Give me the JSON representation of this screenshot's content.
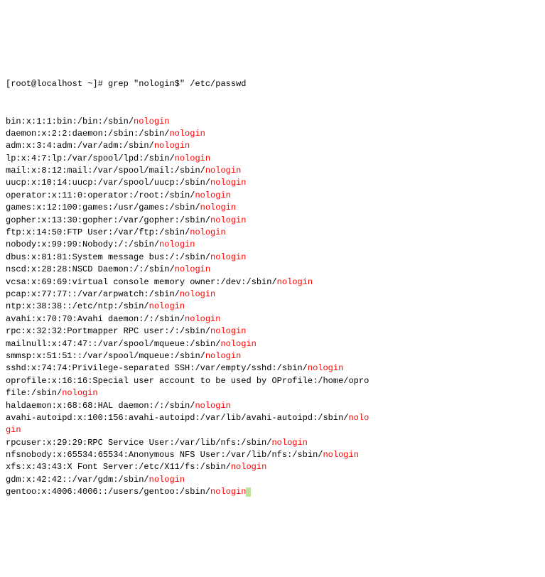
{
  "prompt": "[root@localhost ~]# ",
  "command": "grep \"nologin$\" /etc/passwd",
  "match": "nologin",
  "entries": [
    "bin:x:1:1:bin:/bin:/sbin/",
    "daemon:x:2:2:daemon:/sbin:/sbin/",
    "adm:x:3:4:adm:/var/adm:/sbin/",
    "lp:x:4:7:lp:/var/spool/lpd:/sbin/",
    "mail:x:8:12:mail:/var/spool/mail:/sbin/",
    "uucp:x:10:14:uucp:/var/spool/uucp:/sbin/",
    "operator:x:11:0:operator:/root:/sbin/",
    "games:x:12:100:games:/usr/games:/sbin/",
    "gopher:x:13:30:gopher:/var/gopher:/sbin/",
    "ftp:x:14:50:FTP User:/var/ftp:/sbin/",
    "nobody:x:99:99:Nobody:/:/sbin/",
    "dbus:x:81:81:System message bus:/:/sbin/",
    "nscd:x:28:28:NSCD Daemon:/:/sbin/",
    "vcsa:x:69:69:virtual console memory owner:/dev:/sbin/",
    "pcap:x:77:77::/var/arpwatch:/sbin/",
    "ntp:x:38:38::/etc/ntp:/sbin/",
    "avahi:x:70:70:Avahi daemon:/:/sbin/",
    "rpc:x:32:32:Portmapper RPC user:/:/sbin/",
    "mailnull:x:47:47::/var/spool/mqueue:/sbin/",
    "smmsp:x:51:51::/var/spool/mqueue:/sbin/",
    "sshd:x:74:74:Privilege-separated SSH:/var/empty/sshd:/sbin/",
    "oprofile:x:16:16:Special user account to be used by OProfile:/home/opro\nfile:/sbin/",
    "haldaemon:x:68:68:HAL daemon:/:/sbin/",
    "avahi-autoipd:x:100:156:avahi-autoipd:/var/lib/avahi-autoipd:/sbin/"
  ],
  "wrapped_tail": "nolo\ngin",
  "entries2": [
    "rpcuser:x:29:29:RPC Service User:/var/lib/nfs:/sbin/",
    "nfsnobody:x:65534:65534:Anonymous NFS User:/var/lib/nfs:/sbin/",
    "xfs:x:43:43:X Font Server:/etc/X11/fs:/sbin/",
    "gdm:x:42:42::/var/gdm:/sbin/",
    "gentoo:x:4006:4006::/users/gentoo:/sbin/"
  ]
}
